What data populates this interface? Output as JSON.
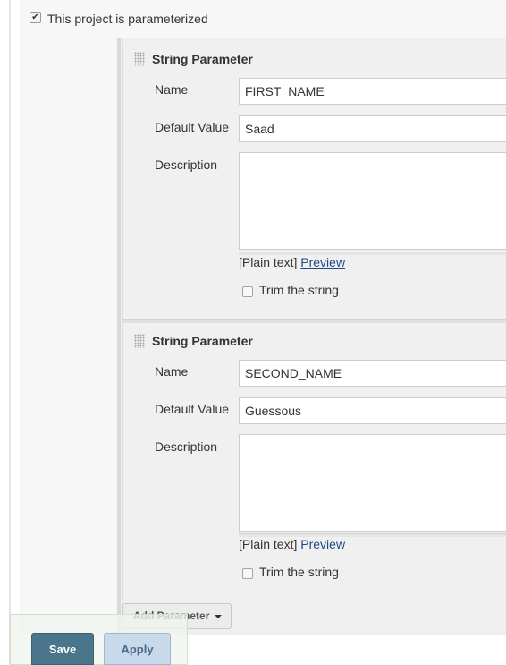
{
  "parameterized": {
    "checked": true,
    "label": "This project is parameterized"
  },
  "parameters": [
    {
      "type_label": "String Parameter",
      "name_label": "Name",
      "name_value": "FIRST_NAME",
      "default_label": "Default Value",
      "default_value": "Saad",
      "description_label": "Description",
      "description_value": "",
      "format_text": "[Plain text]",
      "preview_label": "Preview",
      "trim_label": "Trim the string",
      "trim_checked": false
    },
    {
      "type_label": "String Parameter",
      "name_label": "Name",
      "name_value": "SECOND_NAME",
      "default_label": "Default Value",
      "default_value": "Guessous",
      "description_label": "Description",
      "description_value": "",
      "format_text": "[Plain text]",
      "preview_label": "Preview",
      "trim_label": "Trim the string",
      "trim_checked": false
    }
  ],
  "add_parameter": {
    "label": "Add Parameter",
    "icon": "caret-down-icon"
  },
  "bottom_bar": {
    "save_label": "Save",
    "apply_label": "Apply"
  },
  "colors": {
    "save_button": "#4b758b",
    "apply_button": "#c8d9ec",
    "link": "#204a87"
  }
}
